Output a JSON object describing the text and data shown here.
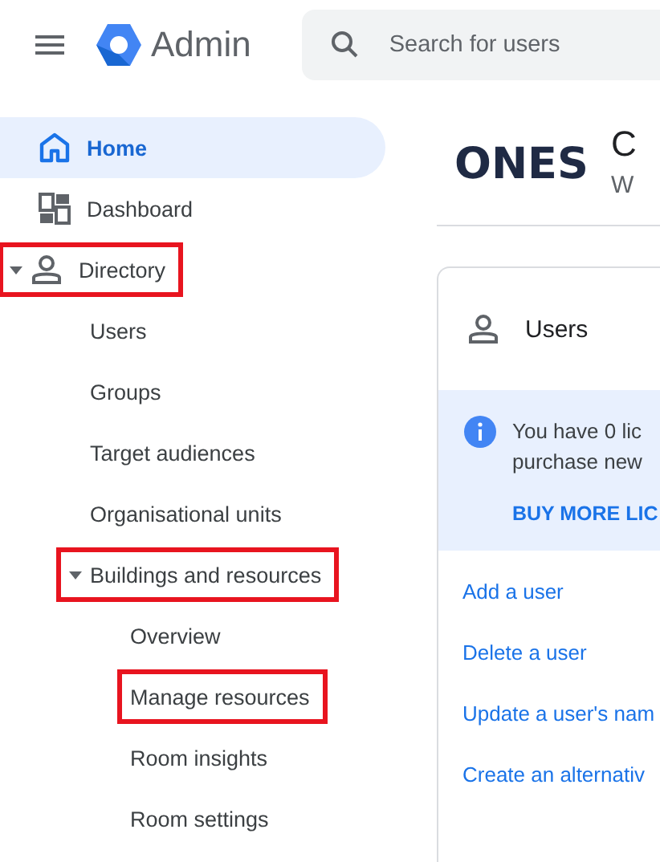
{
  "header": {
    "app_name": "Admin",
    "search": {
      "placeholder": "Search for users"
    }
  },
  "sidebar": {
    "items": [
      {
        "label": "Home",
        "selected": true,
        "highlighted": false
      },
      {
        "label": "Dashboard",
        "selected": false,
        "highlighted": false
      },
      {
        "label": "Directory",
        "selected": false,
        "highlighted": true,
        "expanded": true,
        "children": [
          {
            "label": "Users",
            "selected": false,
            "highlighted": false
          },
          {
            "label": "Groups",
            "selected": false,
            "highlighted": false
          },
          {
            "label": "Target audiences",
            "selected": false,
            "highlighted": false
          },
          {
            "label": "Organisational units",
            "selected": false,
            "highlighted": false
          },
          {
            "label": "Buildings and resources",
            "selected": false,
            "highlighted": true,
            "expanded": true,
            "children": [
              {
                "label": "Overview",
                "selected": false,
                "highlighted": false
              },
              {
                "label": "Manage resources",
                "selected": false,
                "highlighted": true
              },
              {
                "label": "Room insights",
                "selected": false,
                "highlighted": false
              },
              {
                "label": "Room settings",
                "selected": false,
                "highlighted": false
              }
            ]
          }
        ]
      }
    ]
  },
  "organization": {
    "logo": "ONES",
    "title": "C",
    "subtitle": "W"
  },
  "users_card": {
    "title": "Users",
    "notice": {
      "text": "You have 0 lic",
      "text_2": "purchase new",
      "action": "BUY MORE LIC"
    },
    "links": [
      "Add a user",
      "Delete a user",
      "Update a user's nam",
      "Create an alternativ"
    ]
  }
}
